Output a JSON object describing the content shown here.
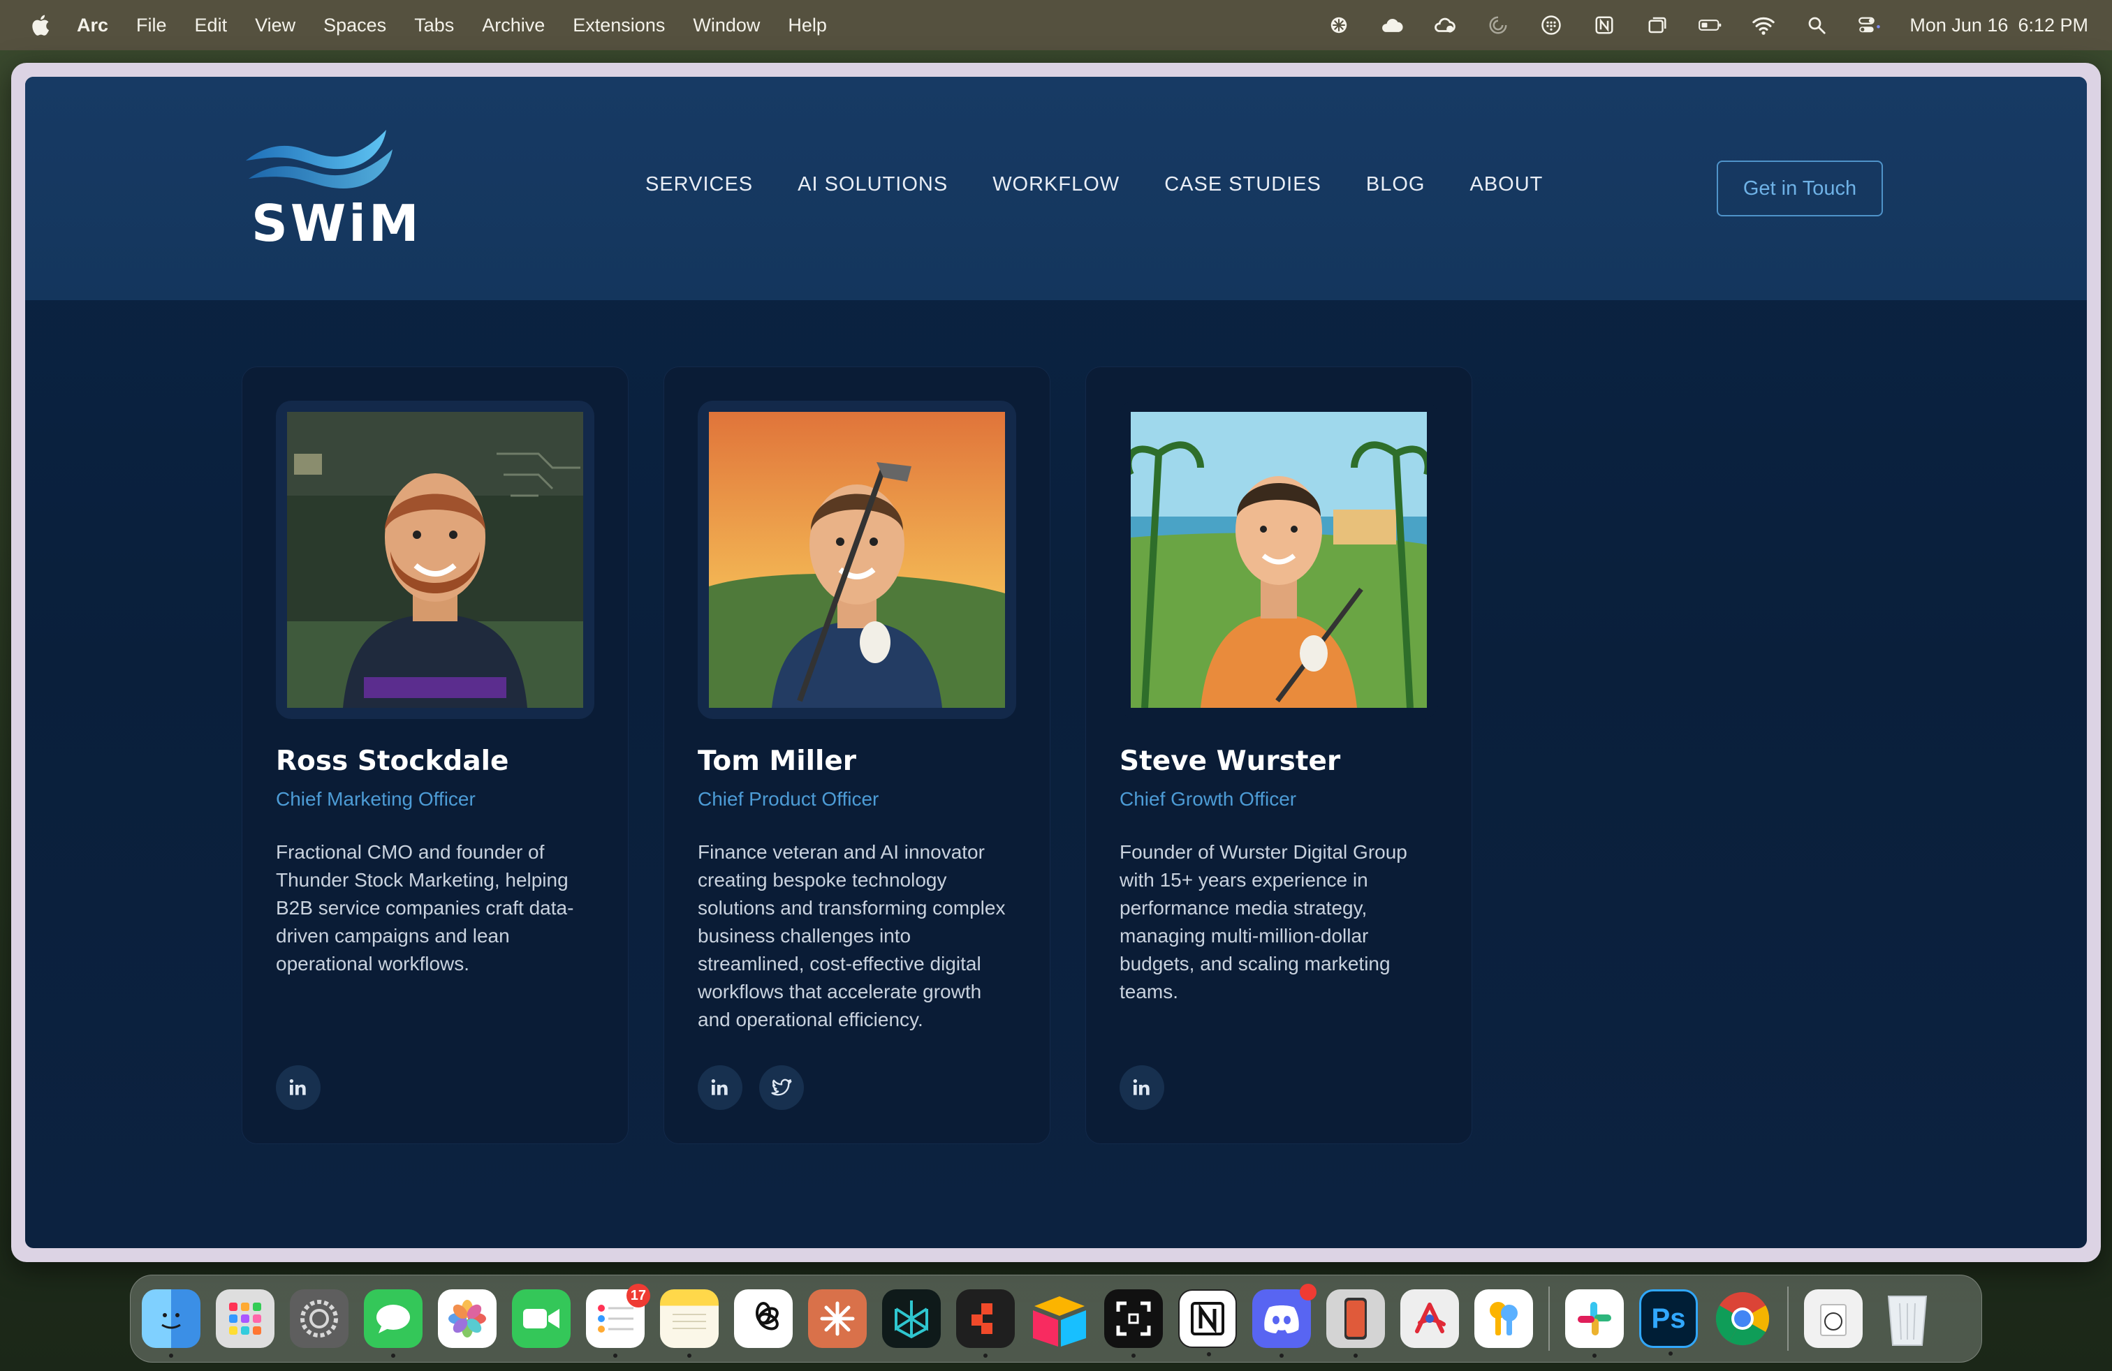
{
  "menubar": {
    "app_name": "Arc",
    "menus": [
      "File",
      "Edit",
      "View",
      "Spaces",
      "Tabs",
      "Archive",
      "Extensions",
      "Window",
      "Help"
    ],
    "date": "Mon Jun 16",
    "time": "6:12 PM"
  },
  "header": {
    "logo_text": "SWiM",
    "nav": [
      "SERVICES",
      "AI SOLUTIONS",
      "WORKFLOW",
      "CASE STUDIES",
      "BLOG",
      "ABOUT"
    ],
    "cta_label": "Get in Touch"
  },
  "team": [
    {
      "name": "Ross Stockdale",
      "role": "Chief Marketing Officer",
      "bio": "Fractional CMO and founder of Thunder Stock Marketing, helping B2B service companies craft data-driven campaigns and lean operational workflows.",
      "socials": [
        "linkedin"
      ]
    },
    {
      "name": "Tom Miller",
      "role": "Chief Product Officer",
      "bio": "Finance veteran and AI innovator creating bespoke technology solutions and transforming complex business challenges into streamlined, cost-effective digital workflows that accelerate growth and operational efficiency.",
      "socials": [
        "linkedin",
        "twitter"
      ]
    },
    {
      "name": "Steve Wurster",
      "role": "Chief Growth Officer",
      "bio": "Founder of Wurster Digital Group with 15+ years experience in performance media strategy, managing multi-million-dollar budgets, and scaling marketing teams.",
      "socials": [
        "linkedin"
      ]
    }
  ],
  "dock": {
    "reminders_badge": "17",
    "ps_label": "Ps"
  },
  "colors": {
    "header_bg": "#173a64",
    "page_bg": "#0b2444",
    "card_bg": "#0a1c36",
    "accent": "#4d9cd6"
  }
}
